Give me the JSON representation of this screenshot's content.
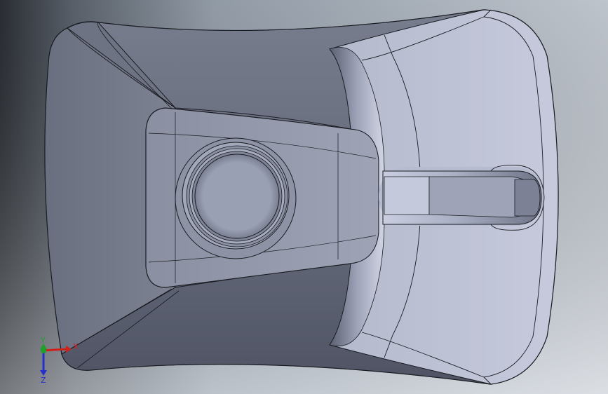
{
  "viewport": {
    "background_top": "#a7b0bd",
    "background_bottom": "#d6dbe1",
    "background_left": "#30343a"
  },
  "triad": {
    "x_label": "X",
    "y_label": "Y",
    "z_label": "Z",
    "x_color": "#d0201c",
    "y_color": "#1fa02a",
    "z_color": "#2430c8"
  },
  "model": {
    "edge_color": "#1a1c22",
    "face_dark": "#5e6372",
    "face_mid": "#7c8191",
    "face_light": "#c4c8da"
  }
}
